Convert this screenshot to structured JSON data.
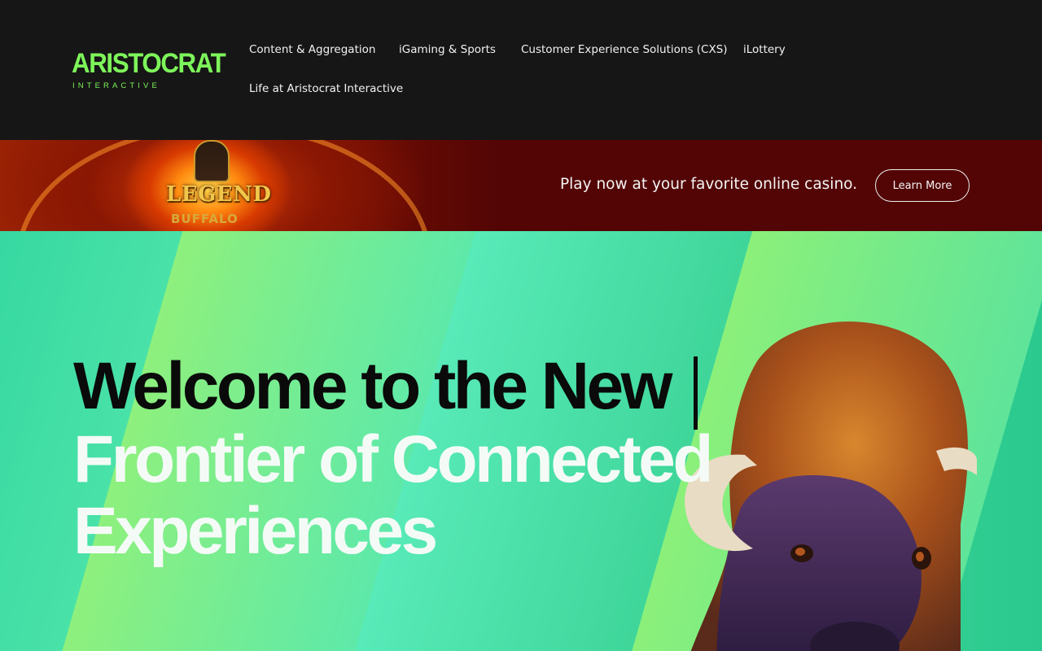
{
  "header": {
    "logo": {
      "main": "ARISTOCRAT",
      "sub": "INTERACTIVE"
    },
    "nav": [
      {
        "label": "Content & Aggregation"
      },
      {
        "label": "iGaming & Sports"
      },
      {
        "label": "Customer Experience Solutions (CXS)"
      },
      {
        "label": "iLottery"
      },
      {
        "label": "Life at Aristocrat Interactive"
      }
    ]
  },
  "promo": {
    "game_logo_line1": "LEGEND",
    "game_logo_line2": "BUFFALO",
    "text": "Play now at your favorite online casino.",
    "button_label": "Learn More"
  },
  "hero": {
    "line1": "Welcome to the New",
    "line2": "Frontier of Connected",
    "line3": "Experiences"
  },
  "colors": {
    "brand_green": "#7df55a",
    "header_bg": "#161616",
    "promo_bg": "#530505",
    "hero_green": "#4fe6a4"
  },
  "icons": {
    "logo": "aristocrat-interactive-logo",
    "promo_art": "legend-of-the-buffalo-game-art",
    "hero_art": "buffalo-illustration"
  }
}
